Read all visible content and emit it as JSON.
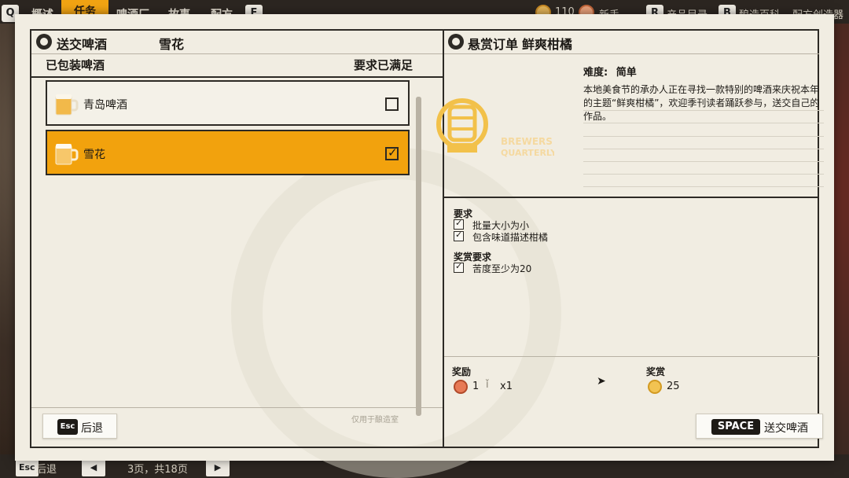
{
  "topbar": {
    "keys": {
      "left": "Q",
      "right": "E"
    },
    "tabs": [
      "概述",
      "任务",
      "啤酒厂",
      "故事",
      "配方"
    ],
    "active_tab": "任务",
    "coins": "110",
    "rank": "新手",
    "hints": [
      {
        "key": "R",
        "label": "产品目录"
      },
      {
        "key": "B",
        "label": "酿造百科"
      },
      {
        "key": "",
        "label": "配方创造器"
      }
    ]
  },
  "left_panel": {
    "title": "送交啤酒",
    "selected_beer_title": "雪花",
    "list_header": "已包装啤酒",
    "status_header": "要求已满足",
    "beers": [
      {
        "name": "青岛啤酒",
        "checked": false
      },
      {
        "name": "雪花",
        "checked": true
      }
    ],
    "note": "仅用于酿造室",
    "back_button": {
      "key": "Esc",
      "label": "后退"
    }
  },
  "right_panel": {
    "title": "悬赏订单",
    "order_name": "鲜爽柑橘",
    "logo": {
      "line1": "BREWERS",
      "line2": "QUARTERLY"
    },
    "difficulty_label": "难度:",
    "difficulty_value": "简单",
    "description": "本地美食节的承办人正在寻找一款特别的啤酒来庆祝本年的主题“鲜爽柑橘”，欢迎季刊读者踊跃参与，送交自己的作品。",
    "requirements_head": "要求",
    "requirements": [
      "批量大小为小",
      "包含味道描述柑橘"
    ],
    "bonus_head": "奖赏要求",
    "bonus": [
      "苦度至少为20"
    ],
    "reward_head": "奖励",
    "reward_amount": "1",
    "reward_multiplier": "x1",
    "bounty_head": "奖赏",
    "bounty_value": "25",
    "submit_button": {
      "key": "SPACE",
      "label": "送交啤酒"
    }
  },
  "bottombar": {
    "key": "Esc",
    "label": "后退",
    "page_info": "3页，共18页"
  }
}
